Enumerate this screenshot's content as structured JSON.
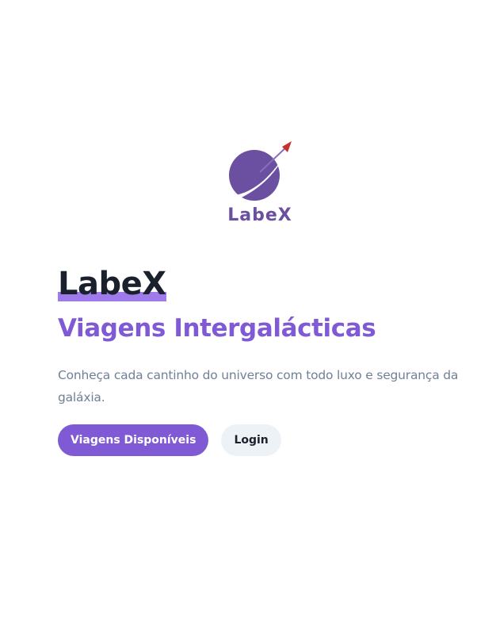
{
  "logo": {
    "text": "LabeX",
    "icon": "planet-rocket-icon",
    "colors": {
      "planet": "#6b4fa0",
      "arrow": "#c53030"
    }
  },
  "hero": {
    "brand": "LabeX",
    "subtitle": "Viagens Intergalácticas",
    "description": "Conheça cada cantinho do universo com todo luxo e segurança da galáxia."
  },
  "buttons": {
    "primary_label": "Viagens Disponíveis",
    "secondary_label": "Login"
  },
  "colors": {
    "accent": "#805ad5",
    "heading": "#1a202c",
    "muted": "#718096"
  }
}
